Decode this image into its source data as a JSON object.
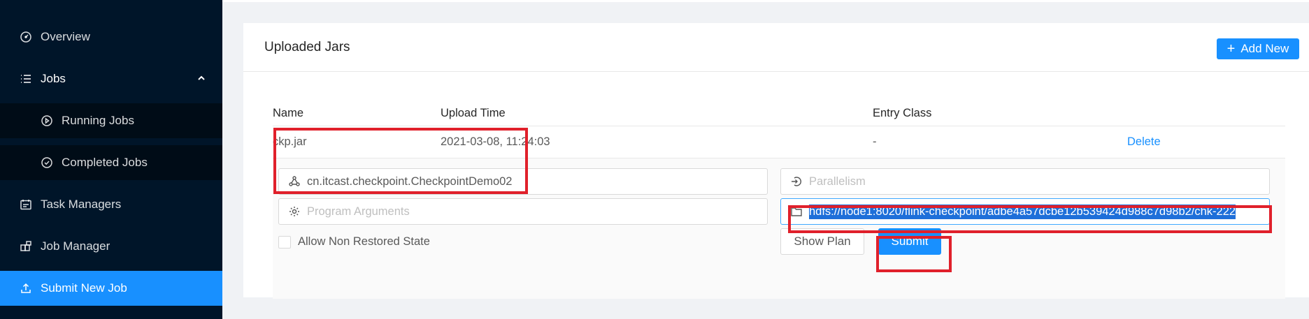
{
  "sidebar": {
    "items": [
      {
        "label": "Overview",
        "icon": "dashboard-icon"
      },
      {
        "label": "Jobs",
        "icon": "list-icon",
        "expanded": true
      },
      {
        "label": "Running Jobs",
        "icon": "play-circle-icon"
      },
      {
        "label": "Completed Jobs",
        "icon": "check-circle-icon"
      },
      {
        "label": "Task Managers",
        "icon": "schedule-icon"
      },
      {
        "label": "Job Manager",
        "icon": "build-icon"
      },
      {
        "label": "Submit New Job",
        "icon": "upload-icon",
        "active": true
      }
    ]
  },
  "card": {
    "title": "Uploaded Jars",
    "add_button": "Add New"
  },
  "table": {
    "columns": [
      "Name",
      "Upload Time",
      "Entry Class"
    ],
    "rows": [
      {
        "name": "ckp.jar",
        "upload_time": "2021-03-08, 11:24:03",
        "entry_class": "-",
        "action": "Delete"
      }
    ]
  },
  "form": {
    "entry_class_value": "cn.itcast.checkpoint.CheckpointDemo02",
    "parallelism_placeholder": "Parallelism",
    "program_args_placeholder": "Program Arguments",
    "savepoint_path_value": "hdfs://node1:8020/flink-checkpoint/adbe4a57dcbe12b539424d988c7d98b2/chk-222",
    "allow_non_restored_label": "Allow Non Restored State",
    "allow_non_restored_checked": false,
    "show_plan_button": "Show Plan",
    "submit_button": "Submit"
  },
  "colors": {
    "sidebar_bg": "#001529",
    "sidebar_sub_bg": "#000c17",
    "accent": "#1890ff",
    "highlight_box": "#e0202b"
  }
}
